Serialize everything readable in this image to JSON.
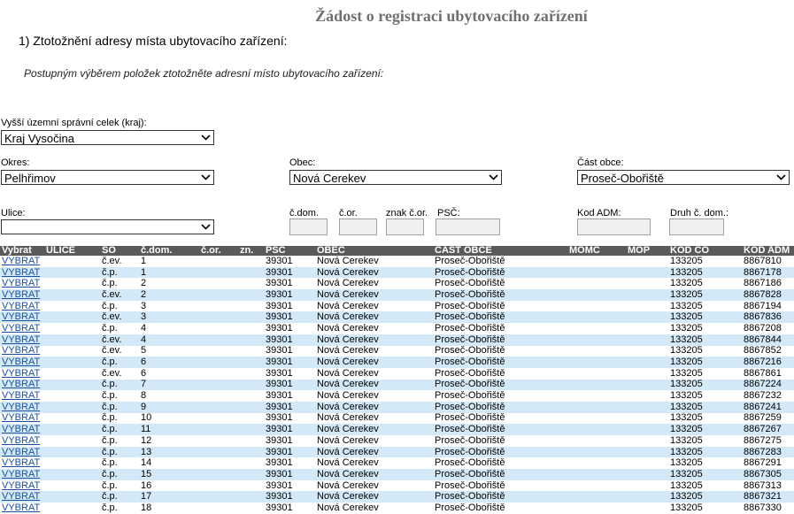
{
  "title": "Žádost o registraci ubytovacího zařízení",
  "step_heading": "1) Ztotožnění adresy místa ubytovacího zařízení:",
  "instruction": "Postupným výběrem položek ztotožněte adresní místo ubytovacího zařízení:",
  "form": {
    "kraj_label": "Vyšší územní správní celek (kraj):",
    "kraj_value": "Kraj Vysočina",
    "okres_label": "Okres:",
    "okres_value": "Pelhřimov",
    "obec_label": "Obec:",
    "obec_value": "Nová Cerekev",
    "cast_label": "Část obce:",
    "cast_value": "Proseč-Obořiště",
    "ulice_label": "Ulice:",
    "ulice_value": "",
    "cdom_label": "č.dom.",
    "cor_label": "č.or.",
    "znak_label": "znak č.or.",
    "psc_label": "PSČ:",
    "kodadm_label": "Kod ADM:",
    "druh_label": "Druh č. dom.:"
  },
  "table": {
    "headers": [
      "Vybrat",
      "ULICE",
      "SO",
      "č.dom.",
      "č.or.",
      "zn.",
      "PSČ",
      "OBEC",
      "ČÁST OBCE",
      "MOMC",
      "MOP",
      "KÓD ČO",
      "KÓD ADM"
    ],
    "rows": [
      [
        "VYBRAT",
        "",
        "č.ev.",
        "1",
        "",
        "",
        "39301",
        "Nová Cerekev",
        "Proseč-Obořiště",
        "",
        "",
        "133205",
        "8867810"
      ],
      [
        "VYBRAT",
        "",
        "č.p.",
        "1",
        "",
        "",
        "39301",
        "Nová Cerekev",
        "Proseč-Obořiště",
        "",
        "",
        "133205",
        "8867178"
      ],
      [
        "VYBRAT",
        "",
        "č.p.",
        "2",
        "",
        "",
        "39301",
        "Nová Cerekev",
        "Proseč-Obořiště",
        "",
        "",
        "133205",
        "8867186"
      ],
      [
        "VYBRAT",
        "",
        "č.ev.",
        "2",
        "",
        "",
        "39301",
        "Nová Cerekev",
        "Proseč-Obořiště",
        "",
        "",
        "133205",
        "8867828"
      ],
      [
        "VYBRAT",
        "",
        "č.p.",
        "3",
        "",
        "",
        "39301",
        "Nová Cerekev",
        "Proseč-Obořiště",
        "",
        "",
        "133205",
        "8867194"
      ],
      [
        "VYBRAT",
        "",
        "č.ev.",
        "3",
        "",
        "",
        "39301",
        "Nová Cerekev",
        "Proseč-Obořiště",
        "",
        "",
        "133205",
        "8867836"
      ],
      [
        "VYBRAT",
        "",
        "č.p.",
        "4",
        "",
        "",
        "39301",
        "Nová Cerekev",
        "Proseč-Obořiště",
        "",
        "",
        "133205",
        "8867208"
      ],
      [
        "VYBRAT",
        "",
        "č.ev.",
        "4",
        "",
        "",
        "39301",
        "Nová Cerekev",
        "Proseč-Obořiště",
        "",
        "",
        "133205",
        "8867844"
      ],
      [
        "VYBRAT",
        "",
        "č.ev.",
        "5",
        "",
        "",
        "39301",
        "Nová Cerekev",
        "Proseč-Obořiště",
        "",
        "",
        "133205",
        "8867852"
      ],
      [
        "VYBRAT",
        "",
        "č.p.",
        "6",
        "",
        "",
        "39301",
        "Nová Cerekev",
        "Proseč-Obořiště",
        "",
        "",
        "133205",
        "8867216"
      ],
      [
        "VYBRAT",
        "",
        "č.ev.",
        "6",
        "",
        "",
        "39301",
        "Nová Cerekev",
        "Proseč-Obořiště",
        "",
        "",
        "133205",
        "8867861"
      ],
      [
        "VYBRAT",
        "",
        "č.p.",
        "7",
        "",
        "",
        "39301",
        "Nová Cerekev",
        "Proseč-Obořiště",
        "",
        "",
        "133205",
        "8867224"
      ],
      [
        "VYBRAT",
        "",
        "č.p.",
        "8",
        "",
        "",
        "39301",
        "Nová Cerekev",
        "Proseč-Obořiště",
        "",
        "",
        "133205",
        "8867232"
      ],
      [
        "VYBRAT",
        "",
        "č.p.",
        "9",
        "",
        "",
        "39301",
        "Nová Cerekev",
        "Proseč-Obořiště",
        "",
        "",
        "133205",
        "8867241"
      ],
      [
        "VYBRAT",
        "",
        "č.p.",
        "10",
        "",
        "",
        "39301",
        "Nová Cerekev",
        "Proseč-Obořiště",
        "",
        "",
        "133205",
        "8867259"
      ],
      [
        "VYBRAT",
        "",
        "č.p.",
        "11",
        "",
        "",
        "39301",
        "Nová Cerekev",
        "Proseč-Obořiště",
        "",
        "",
        "133205",
        "8867267"
      ],
      [
        "VYBRAT",
        "",
        "č.p.",
        "12",
        "",
        "",
        "39301",
        "Nová Cerekev",
        "Proseč-Obořiště",
        "",
        "",
        "133205",
        "8867275"
      ],
      [
        "VYBRAT",
        "",
        "č.p.",
        "13",
        "",
        "",
        "39301",
        "Nová Cerekev",
        "Proseč-Obořiště",
        "",
        "",
        "133205",
        "8867283"
      ],
      [
        "VYBRAT",
        "",
        "č.p.",
        "14",
        "",
        "",
        "39301",
        "Nová Cerekev",
        "Proseč-Obořiště",
        "",
        "",
        "133205",
        "8867291"
      ],
      [
        "VYBRAT",
        "",
        "č.p.",
        "15",
        "",
        "",
        "39301",
        "Nová Cerekev",
        "Proseč-Obořiště",
        "",
        "",
        "133205",
        "8867305"
      ],
      [
        "VYBRAT",
        "",
        "č.p.",
        "16",
        "",
        "",
        "39301",
        "Nová Cerekev",
        "Proseč-Obořiště",
        "",
        "",
        "133205",
        "8867313"
      ],
      [
        "VYBRAT",
        "",
        "č.p.",
        "17",
        "",
        "",
        "39301",
        "Nová Cerekev",
        "Proseč-Obořiště",
        "",
        "",
        "133205",
        "8867321"
      ],
      [
        "VYBRAT",
        "",
        "č.p.",
        "18",
        "",
        "",
        "39301",
        "Nová Cerekev",
        "Proseč-Obořiště",
        "",
        "",
        "133205",
        "8867330"
      ]
    ]
  }
}
